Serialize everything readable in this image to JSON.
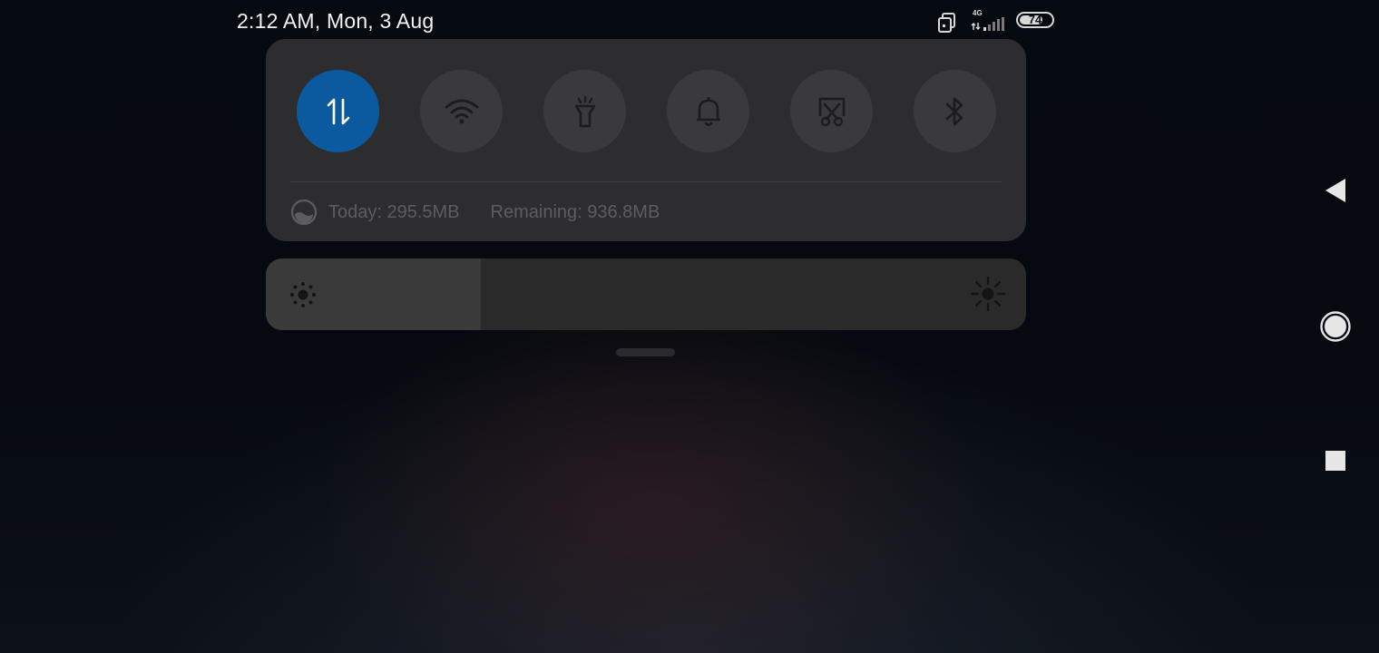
{
  "status_bar": {
    "clock": "2:12 AM, Mon, 3 Aug",
    "network_type": "4G",
    "battery_level": "74",
    "battery_fraction": 0.74,
    "icons": [
      "dual-sim-icon",
      "signal-icon",
      "battery-icon"
    ]
  },
  "quick_settings": {
    "tiles": [
      {
        "name": "mobile-data",
        "icon": "data-transfer-icon",
        "active": true
      },
      {
        "name": "wifi",
        "icon": "wifi-icon",
        "active": false
      },
      {
        "name": "flashlight",
        "icon": "flashlight-icon",
        "active": false
      },
      {
        "name": "sound",
        "icon": "bell-icon",
        "active": false
      },
      {
        "name": "screenshot",
        "icon": "scissors-icon",
        "active": false
      },
      {
        "name": "bluetooth",
        "icon": "bluetooth-icon",
        "active": false
      }
    ],
    "colors": {
      "active": "#0b5aa0",
      "inactive": "#3a3a3c"
    },
    "data_usage": {
      "today": "Today: 295.5MB",
      "remaining": "Remaining: 936.8MB"
    }
  },
  "brightness": {
    "level": 0.283,
    "low_icon": "sun-dim-icon",
    "high_icon": "sun-bright-icon"
  },
  "navigation": {
    "buttons": [
      "back-icon",
      "home-icon",
      "recents-icon"
    ]
  }
}
